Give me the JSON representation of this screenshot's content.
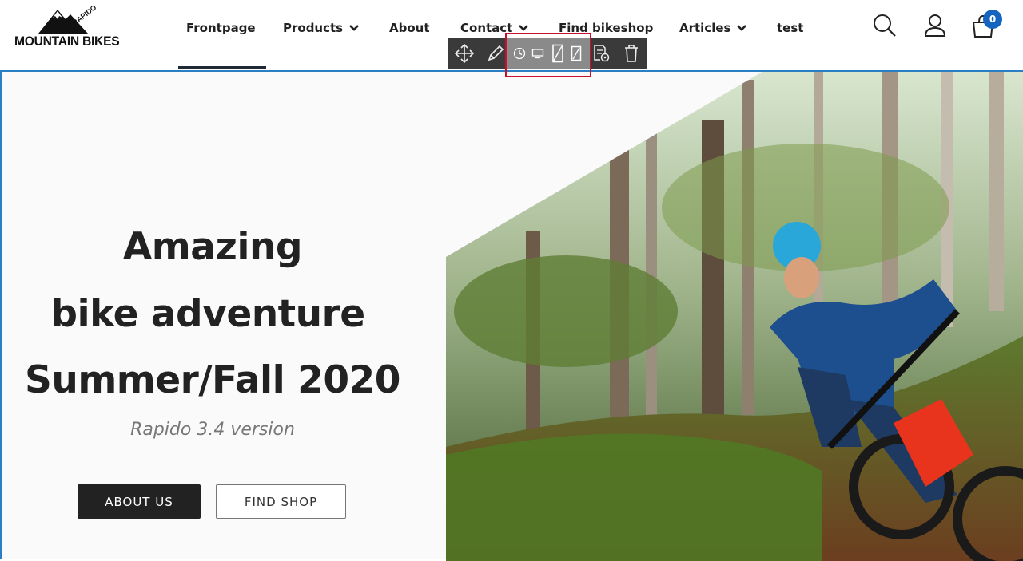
{
  "logo": {
    "text": "MOUNTAIN BIKES",
    "tagline": "RAPIDO"
  },
  "nav": {
    "items": [
      {
        "label": "Frontpage",
        "has_dropdown": false
      },
      {
        "label": "Products",
        "has_dropdown": true
      },
      {
        "label": "About",
        "has_dropdown": false
      },
      {
        "label": "Contact",
        "has_dropdown": true
      },
      {
        "label": "Find bikeshop",
        "has_dropdown": false
      },
      {
        "label": "Articles",
        "has_dropdown": true
      },
      {
        "label": "test",
        "has_dropdown": false
      }
    ],
    "active": "Frontpage"
  },
  "header_icons": {
    "search": "search-icon",
    "account": "user-icon",
    "cart": "shopping-bag-icon",
    "cart_count": "0"
  },
  "toolbar": {
    "buttons": [
      "move-icon",
      "edit-pencil-icon",
      "clock-icon",
      "desktop-icon",
      "tablet-icon",
      "mobile-icon",
      "page-settings-icon",
      "trash-icon"
    ],
    "highlighted_group": [
      "clock-icon",
      "desktop-icon",
      "tablet-icon",
      "mobile-icon"
    ]
  },
  "hero": {
    "line1": "Amazing",
    "line2": "bike adventure",
    "line3": "Summer/Fall 2020",
    "subtitle": "Rapido 3.4 version",
    "primary_button": "ABOUT US",
    "secondary_button": "FIND SHOP",
    "photo_alt": "mountain-biker-in-forest"
  },
  "colors": {
    "accent": "#1565c0",
    "frame_border": "#2a7fc4",
    "highlight": "#c8102e",
    "toolbar": "#3a3a3a"
  }
}
